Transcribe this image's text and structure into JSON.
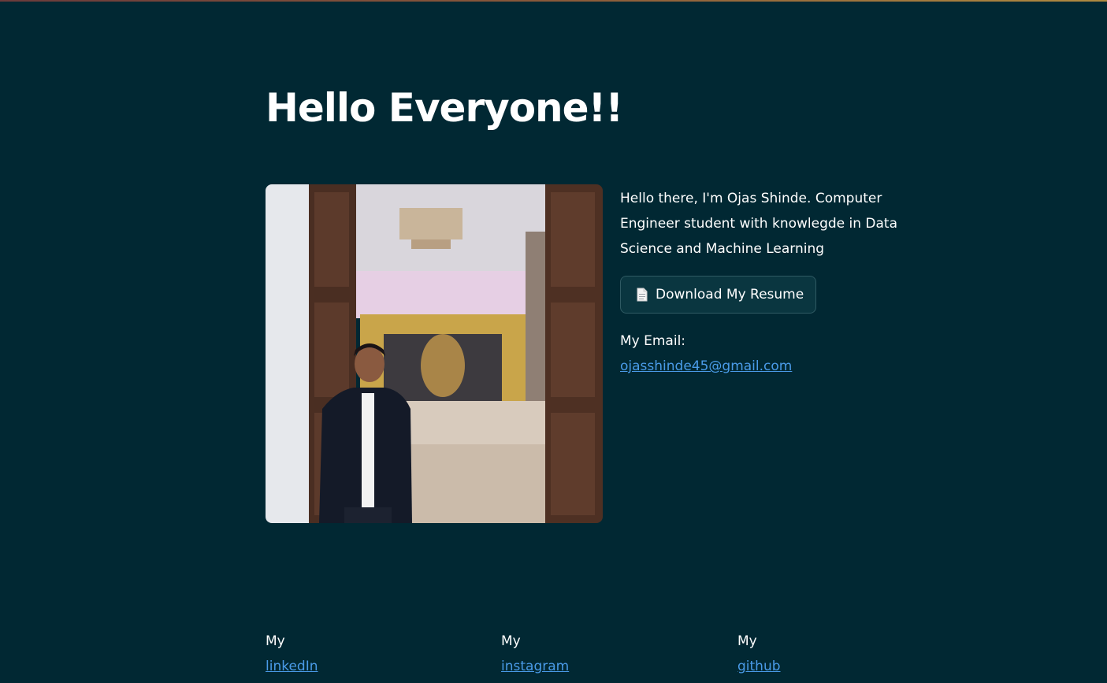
{
  "hero": {
    "title": "Hello Everyone!!"
  },
  "about": {
    "bio": "Hello there, I'm Ojas Shinde. Computer Engineer student with knowlegde in Data Science and Machine Learning",
    "resume_button_label": "Download My Resume",
    "resume_icon": "document-icon",
    "email_label": "My Email:",
    "email": "ojasshinde45@gmail.com"
  },
  "socials": [
    {
      "prefix": "My",
      "label": "linkedIn"
    },
    {
      "prefix": "My",
      "label": "instagram"
    },
    {
      "prefix": "My",
      "label": "github"
    }
  ],
  "colors": {
    "background": "#012833",
    "link": "#4a9be8",
    "text": "#ffffff"
  }
}
